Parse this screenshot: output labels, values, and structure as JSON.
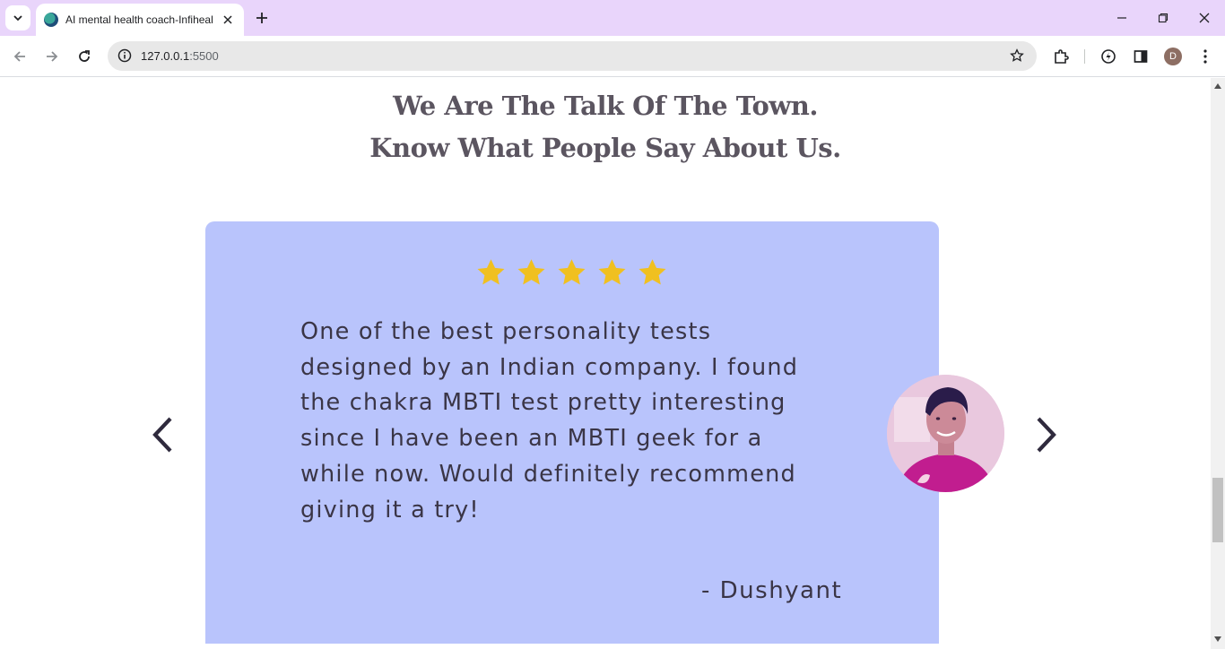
{
  "browser": {
    "tab_title": "AI mental health coach-Infiheal",
    "url_host": "127.0.0.1",
    "url_port": ":5500",
    "profile_initial": "D"
  },
  "page": {
    "heading_line1": "We Are The Talk Of The Town.",
    "heading_line2": "Know What People Say About Us."
  },
  "testimonial": {
    "rating": 5,
    "rating_max": 5,
    "quote_lines": [
      "One of the best personality tests",
      "designed by an Indian company. I found",
      "the chakra MBTI test pretty interesting",
      "since I have been an MBTI geek for a",
      "while now. Would definitely recommend",
      "giving it a try!"
    ],
    "author": "- Dushyant"
  },
  "colors": {
    "card_background": "#b9c4fc",
    "star": "#f0c020",
    "heading": "#5b5560",
    "text": "#3a3546",
    "tabbar": "#e9d5fb"
  },
  "icons": {
    "prev": "chevron-left-icon",
    "next": "chevron-right-icon",
    "star": "star-icon"
  }
}
